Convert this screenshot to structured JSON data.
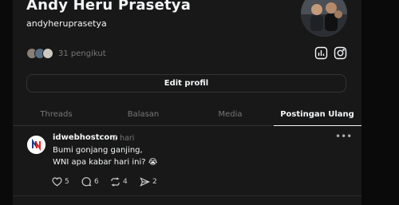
{
  "profile": {
    "name": "Andy Heru Prasetya",
    "handle": "andyheruprasetya",
    "followers_text": "31 pengikut"
  },
  "icons": {
    "insights": "bar-chart-icon",
    "instagram": "instagram-icon"
  },
  "edit_button": {
    "label": "Edit profil"
  },
  "tabs": [
    {
      "label": "Threads",
      "active": false
    },
    {
      "label": "Balasan",
      "active": false
    },
    {
      "label": "Media",
      "active": false
    },
    {
      "label": "Postingan Ulang",
      "active": true
    }
  ],
  "post": {
    "author": "idwebhostcom",
    "time": "2 hari",
    "lines": [
      "Bumi gonjang ganjing,",
      "WNI apa kabar hari ini? 😭"
    ],
    "likes": "5",
    "comments": "6",
    "reposts": "4",
    "shares": "2"
  },
  "colors": {
    "background": "#0a0a0a",
    "panel": "#181818",
    "text_primary": "#f3f5f7",
    "text_secondary": "#777777",
    "border": "#333333"
  }
}
